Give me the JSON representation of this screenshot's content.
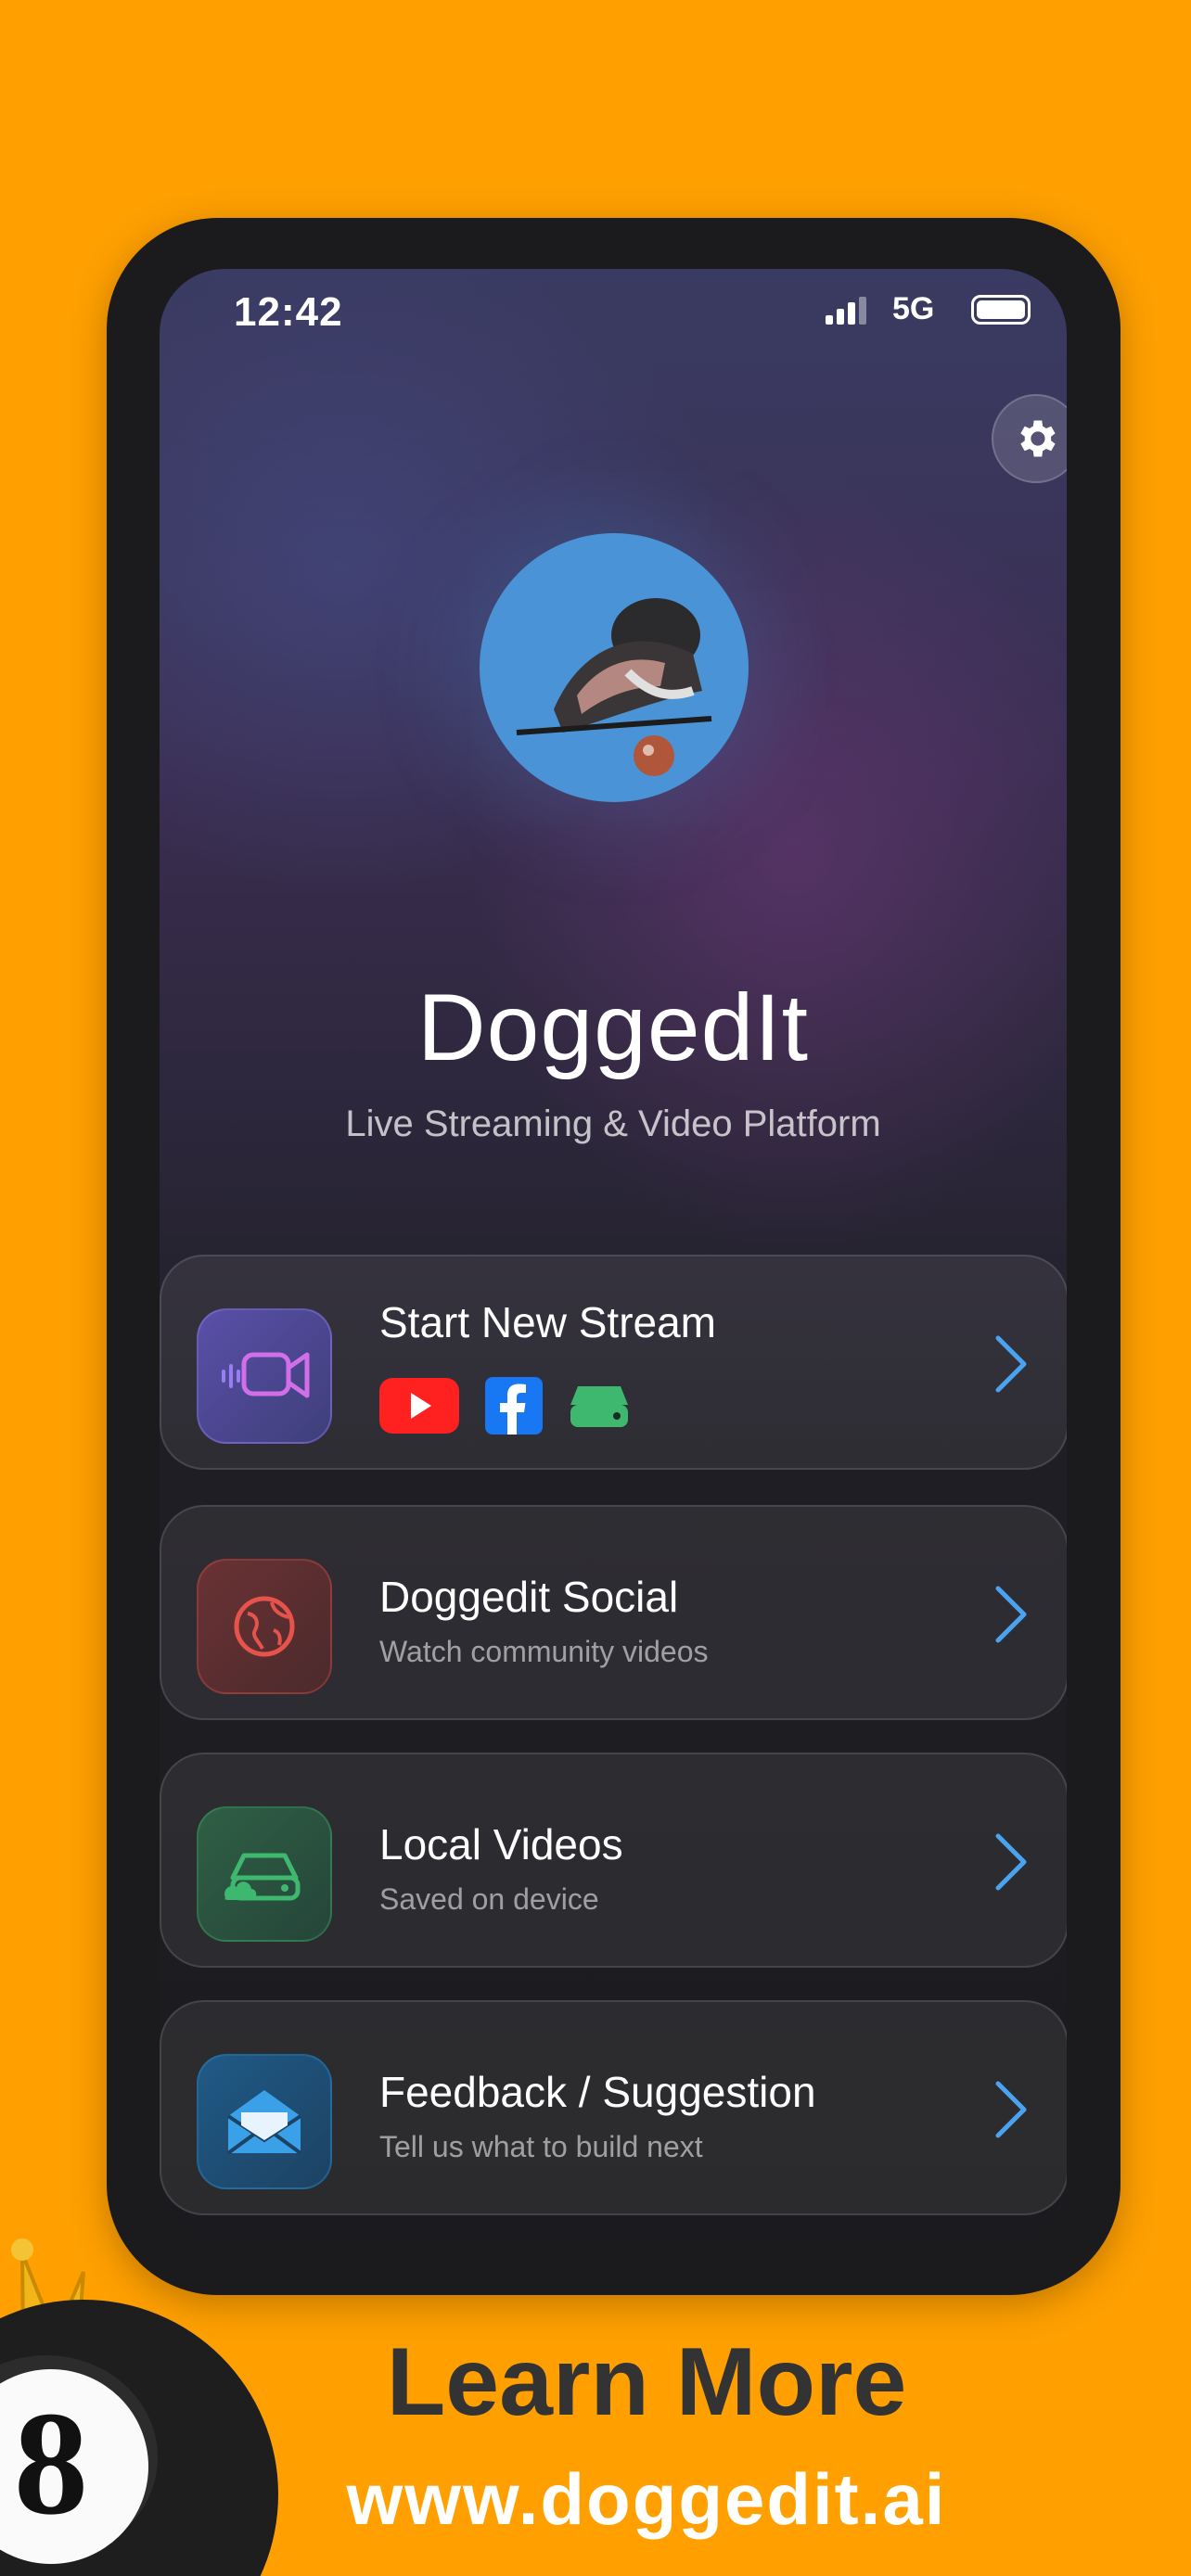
{
  "status_bar": {
    "time": "12:42",
    "network": "5G"
  },
  "app": {
    "title": "DoggedIt",
    "subtitle": "Live Streaming & Video Platform"
  },
  "menu": [
    {
      "id": "stream",
      "title": "Start New Stream",
      "subtitle": "",
      "icon": "video-camera-icon",
      "accent": "#8a63d2",
      "platforms": [
        "youtube-icon",
        "facebook-icon",
        "storage-icon"
      ]
    },
    {
      "id": "social",
      "title": "Doggedit Social",
      "subtitle": "Watch community videos",
      "icon": "globe-icon",
      "accent": "#e5534b"
    },
    {
      "id": "local",
      "title": "Local Videos",
      "subtitle": "Saved on device",
      "icon": "local-storage-icon",
      "accent": "#3fb86f"
    },
    {
      "id": "feedback",
      "title": "Feedback / Suggestion",
      "subtitle": "Tell us what to build next",
      "icon": "envelope-icon",
      "accent": "#2a8fd4"
    }
  ],
  "promo": {
    "learn_more": "Learn More",
    "website": "www.doggedit.ai"
  },
  "colors": {
    "background": "#FFA000",
    "chevron": "#4aa3f0"
  }
}
